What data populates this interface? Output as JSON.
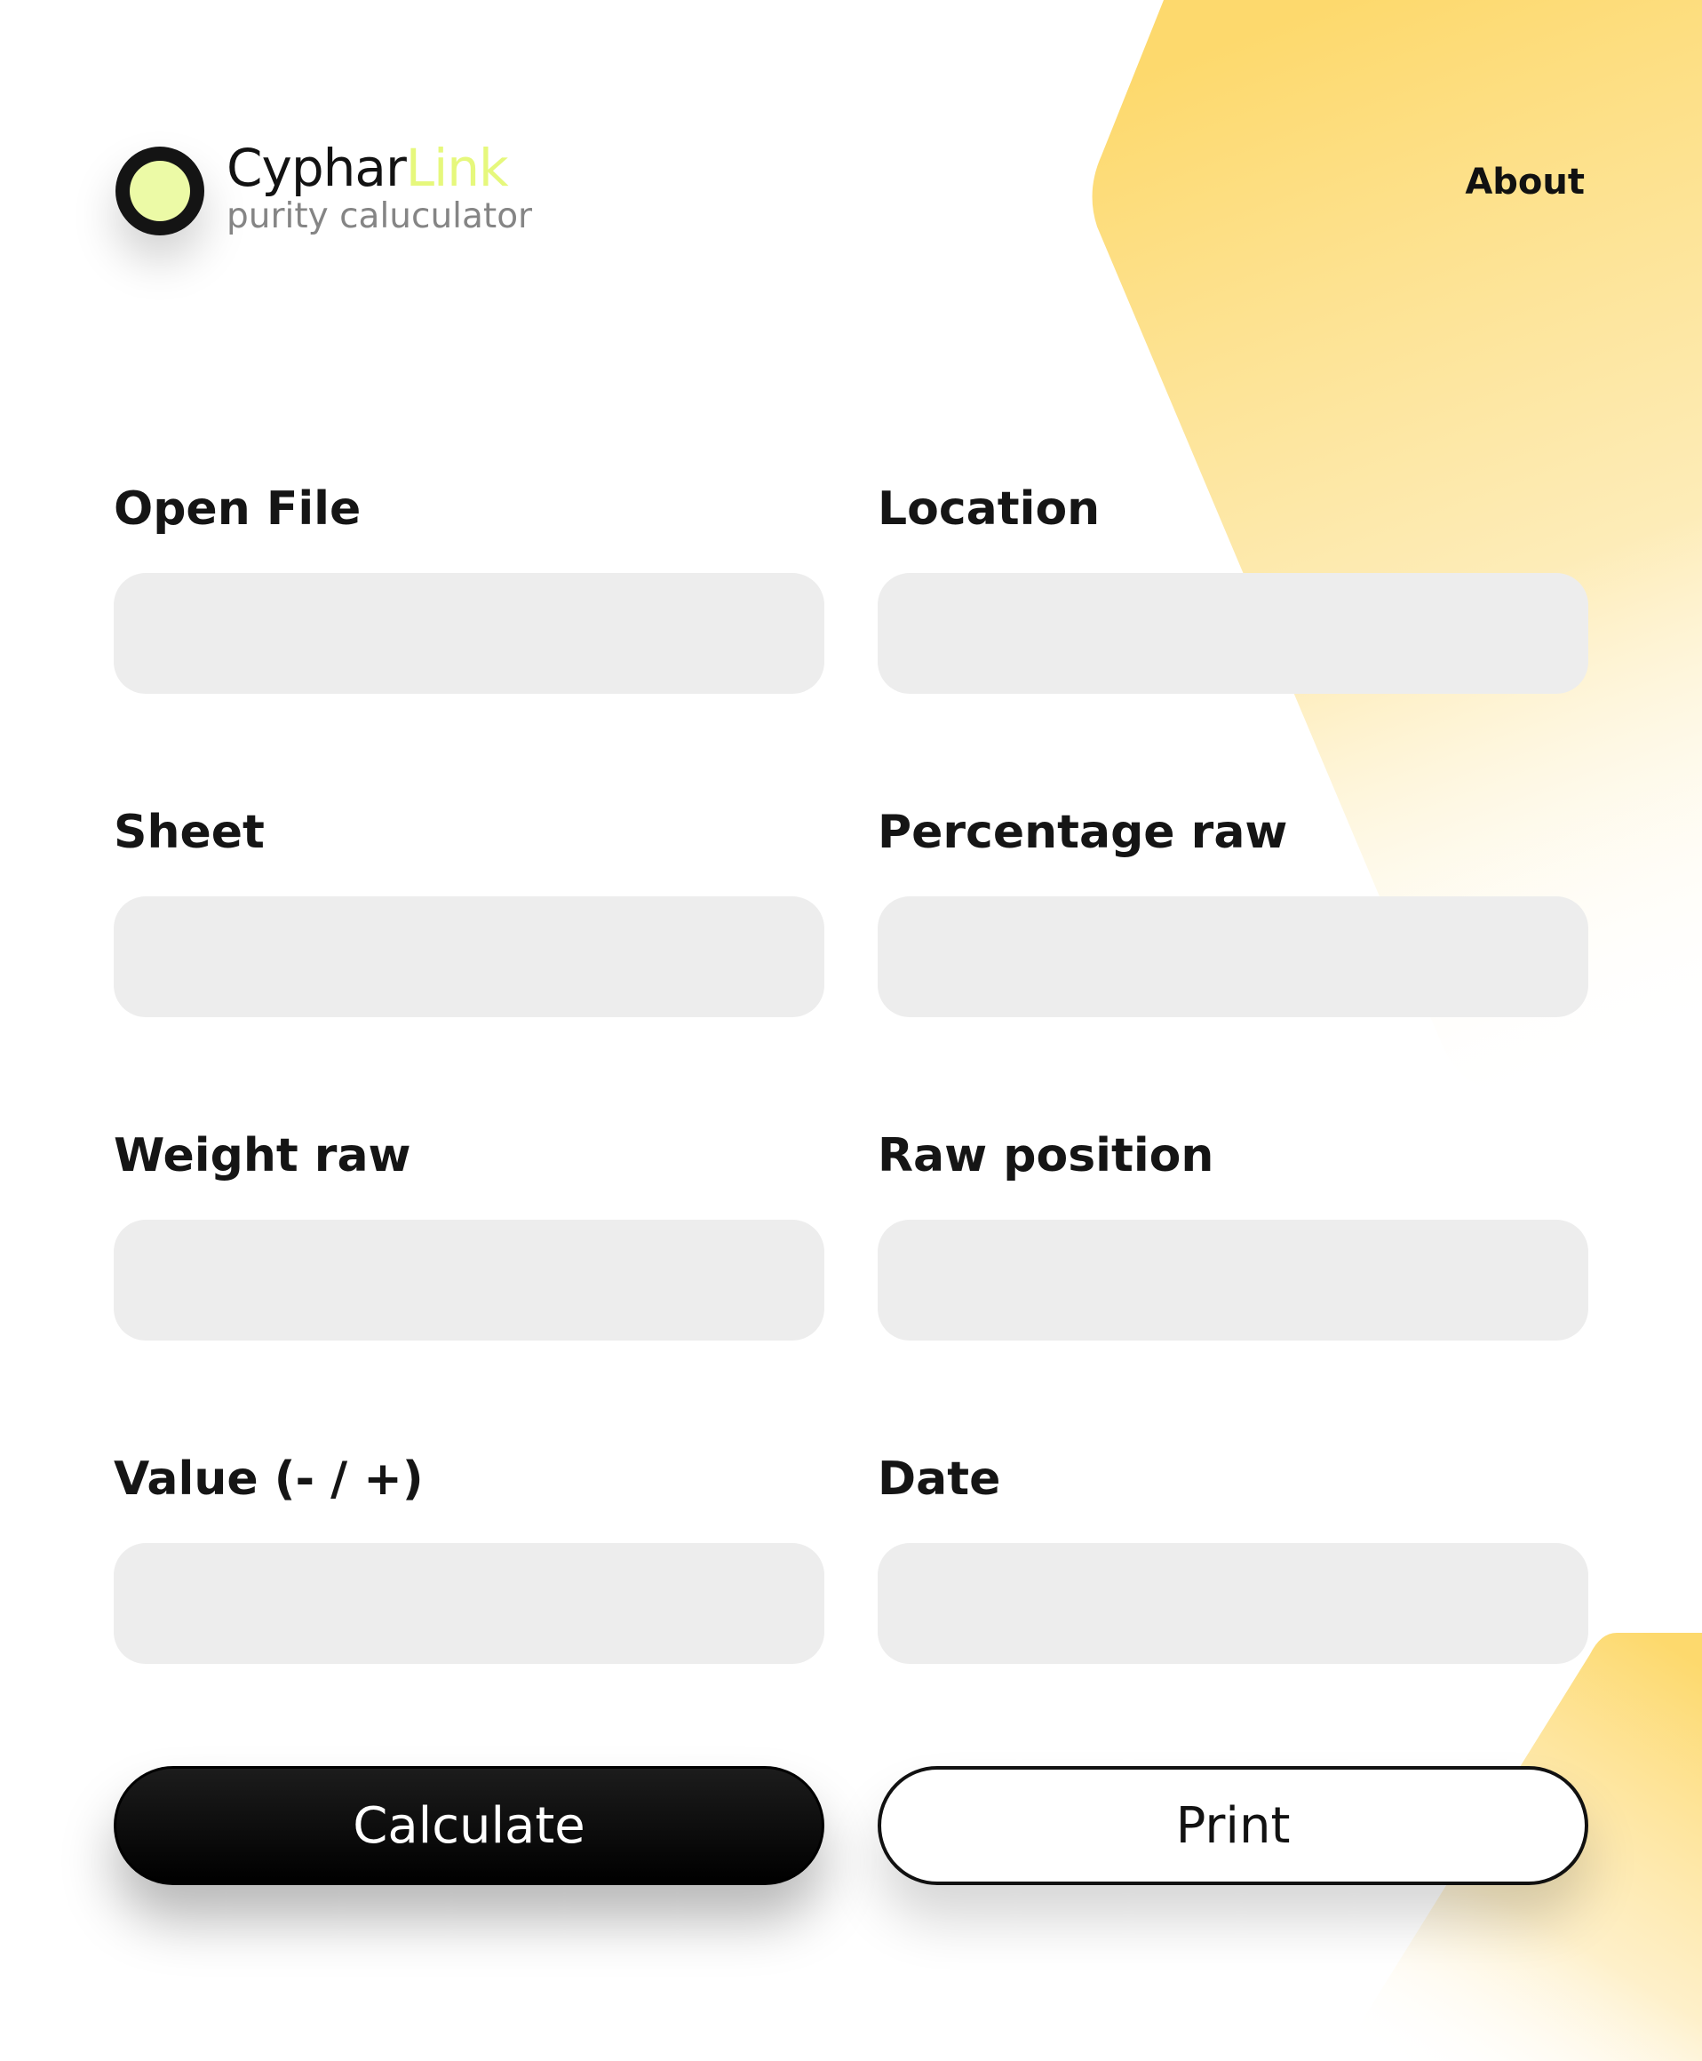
{
  "header": {
    "brand_name_part1": "Cyphar",
    "brand_name_part2": "Link",
    "tagline": "purity caluculator",
    "nav_about": "About"
  },
  "form": {
    "fields": [
      {
        "label": "Open File",
        "value": ""
      },
      {
        "label": "Location",
        "value": ""
      },
      {
        "label": "Sheet",
        "value": ""
      },
      {
        "label": "Percentage raw",
        "value": ""
      },
      {
        "label": "Weight raw",
        "value": ""
      },
      {
        "label": "Raw position",
        "value": ""
      },
      {
        "label": "Value (- / +)",
        "value": ""
      },
      {
        "label": "Date",
        "value": ""
      }
    ]
  },
  "actions": {
    "calculate_label": "Calculate",
    "print_label": "Print"
  },
  "colors": {
    "accent_yellow": "#fdd96d",
    "logo_core": "#ecfaa6",
    "brand_highlight": "#e6f87c",
    "input_bg": "#ededed",
    "text_dark": "#111111",
    "text_muted": "#858585"
  },
  "icons": {
    "logo": "circle-logo-icon"
  }
}
